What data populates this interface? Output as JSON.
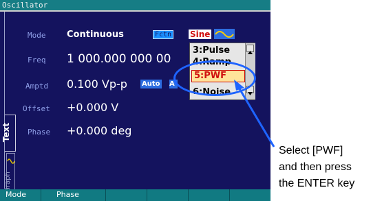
{
  "window": {
    "title": "Oscillator"
  },
  "params": {
    "mode_label": "Mode",
    "mode_value": "Continuous",
    "freq_label": "Freq",
    "freq_value": "1 000.000 000 00",
    "amptd_label": "Amptd",
    "amptd_value": "0.100 Vp-p",
    "offset_label": "Offset",
    "offset_value": "+0.000 V",
    "phase_label": "Phase",
    "phase_value": "+0.000 deg"
  },
  "badges": {
    "fctn": "Fctn",
    "waveform": "Sine",
    "auto": "Auto",
    "auto2": "A"
  },
  "tabs": {
    "text": "Text",
    "graph": "Graph"
  },
  "dropdown": {
    "items": [
      "3:Pulse",
      "4:Ramp",
      "5:PWF",
      "6:Noise"
    ],
    "selected": "5:PWF"
  },
  "softkeys": [
    "Mode",
    "Phase",
    "",
    "",
    "",
    ""
  ],
  "annotation": {
    "line1": "Select [PWF]",
    "line2": "and then press",
    "line3": "the ENTER key"
  },
  "colors": {
    "screen_bg": "#14135e",
    "title_bg": "#167d85",
    "highlight": "#1e64ff",
    "selected_text": "#d01010"
  }
}
